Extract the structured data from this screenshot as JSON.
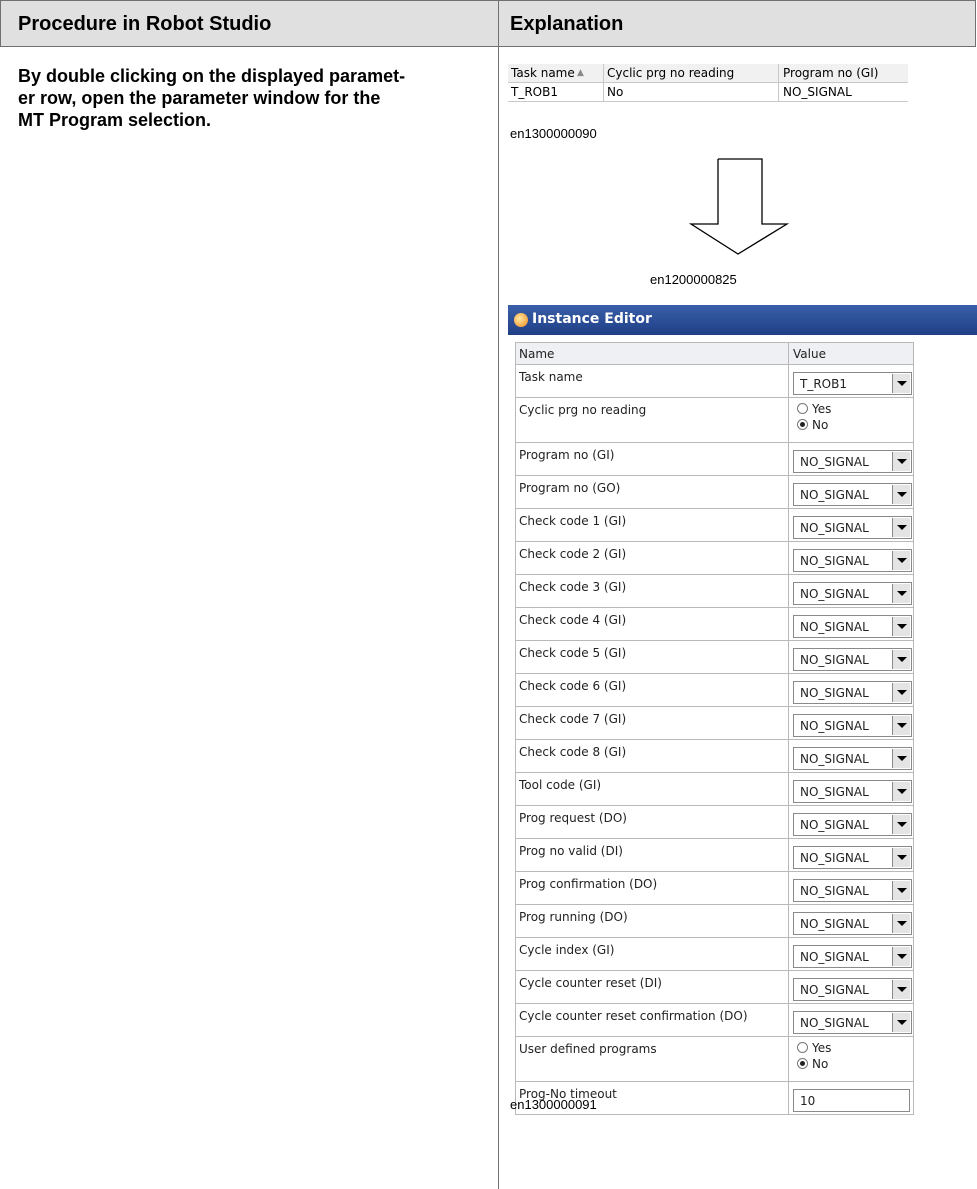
{
  "table": {
    "col_left_header": "Procedure in Robot Studio",
    "col_right_header": "Explanation"
  },
  "procedure": {
    "line1": "By double clicking on the displayed paramet-",
    "line2": "er row, open the parameter window for the",
    "line3": "MT Program selection."
  },
  "mini_grid": {
    "headers": [
      "Task name",
      "Cyclic prg no reading",
      "Program no (GI)"
    ],
    "row": [
      "T_ROB1",
      "No",
      "NO_SIGNAL"
    ]
  },
  "captions": {
    "top": "en1300000090",
    "arrow": "en1200000825",
    "bottom": "en1300000091"
  },
  "instance_editor": {
    "title": "Instance Editor",
    "col_name": "Name",
    "col_value": "Value",
    "rows": [
      {
        "name": "Task name",
        "value": "T_ROB1"
      },
      {
        "name": "Cyclic prg no reading",
        "options": [
          "Yes",
          "No"
        ],
        "selected": "No"
      },
      {
        "name": "Program no (GI)",
        "value": "NO_SIGNAL"
      },
      {
        "name": "Program no (GO)",
        "value": "NO_SIGNAL"
      },
      {
        "name": "Check code 1 (GI)",
        "value": "NO_SIGNAL"
      },
      {
        "name": "Check code 2 (GI)",
        "value": "NO_SIGNAL"
      },
      {
        "name": "Check code 3 (GI)",
        "value": "NO_SIGNAL"
      },
      {
        "name": "Check code 4 (GI)",
        "value": "NO_SIGNAL"
      },
      {
        "name": "Check code 5 (GI)",
        "value": "NO_SIGNAL"
      },
      {
        "name": "Check code 6 (GI)",
        "value": "NO_SIGNAL"
      },
      {
        "name": "Check code 7 (GI)",
        "value": "NO_SIGNAL"
      },
      {
        "name": "Check code 8 (GI)",
        "value": "NO_SIGNAL"
      },
      {
        "name": "Tool code (GI)",
        "value": "NO_SIGNAL"
      },
      {
        "name": "Prog request (DO)",
        "value": "NO_SIGNAL"
      },
      {
        "name": "Prog no valid (DI)",
        "value": "NO_SIGNAL"
      },
      {
        "name": "Prog confirmation (DO)",
        "value": "NO_SIGNAL"
      },
      {
        "name": "Prog running (DO)",
        "value": "NO_SIGNAL"
      },
      {
        "name": "Cycle index (GI)",
        "value": "NO_SIGNAL"
      },
      {
        "name": "Cycle counter reset (DI)",
        "value": "NO_SIGNAL"
      },
      {
        "name": "Cycle counter reset confirmation (DO)",
        "value": "NO_SIGNAL"
      },
      {
        "name": "User defined programs",
        "options": [
          "Yes",
          "No"
        ],
        "selected": "No"
      },
      {
        "name": "Prog-No timeout",
        "value": "10"
      }
    ]
  }
}
